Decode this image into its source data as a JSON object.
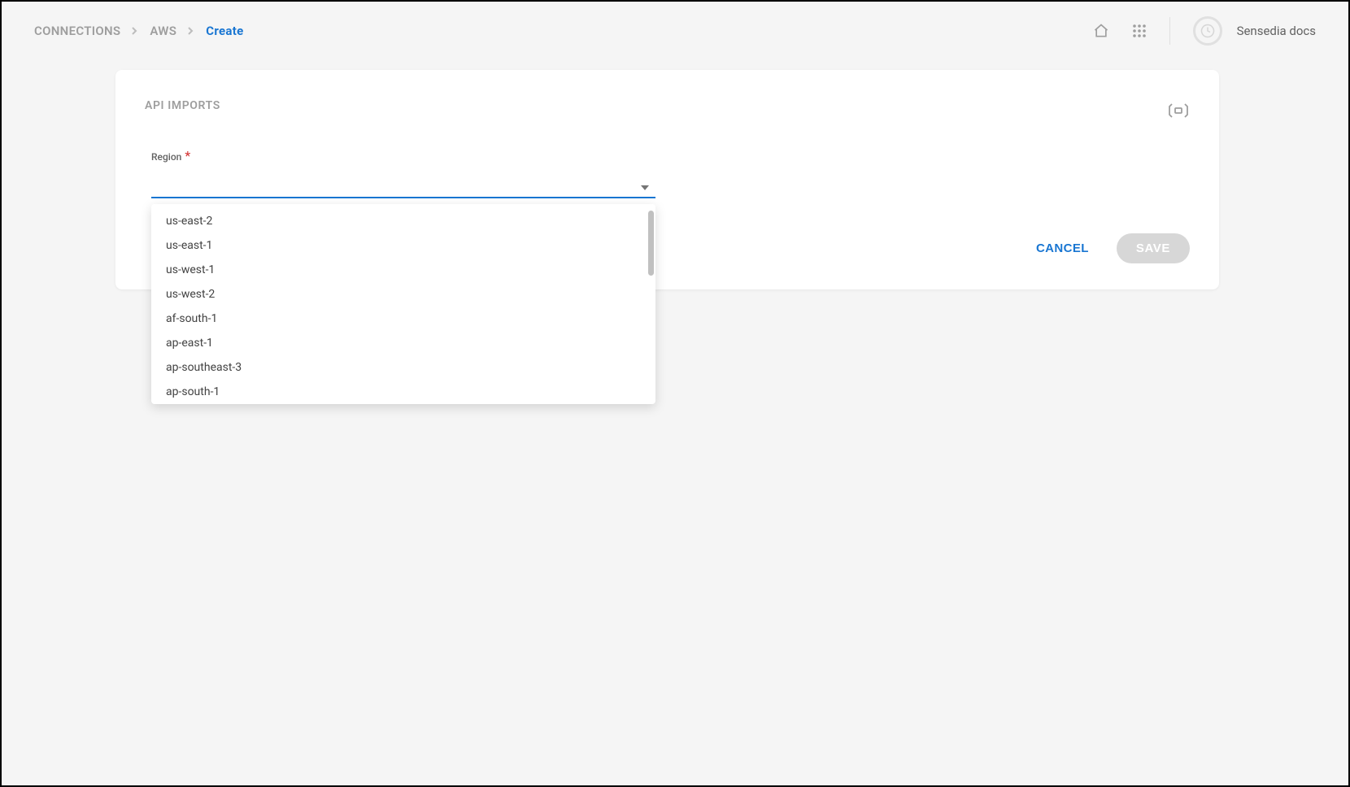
{
  "breadcrumb": {
    "items": [
      {
        "label": "CONNECTIONS"
      },
      {
        "label": "AWS"
      }
    ],
    "current": "Create"
  },
  "header": {
    "username": "Sensedia docs"
  },
  "card": {
    "title": "API IMPORTS",
    "region_label": "Region",
    "region_value": "",
    "region_options": [
      "us-east-2",
      "us-east-1",
      "us-west-1",
      "us-west-2",
      "af-south-1",
      "ap-east-1",
      "ap-southeast-3",
      "ap-south-1"
    ],
    "cancel_label": "CANCEL",
    "save_label": "SAVE"
  }
}
